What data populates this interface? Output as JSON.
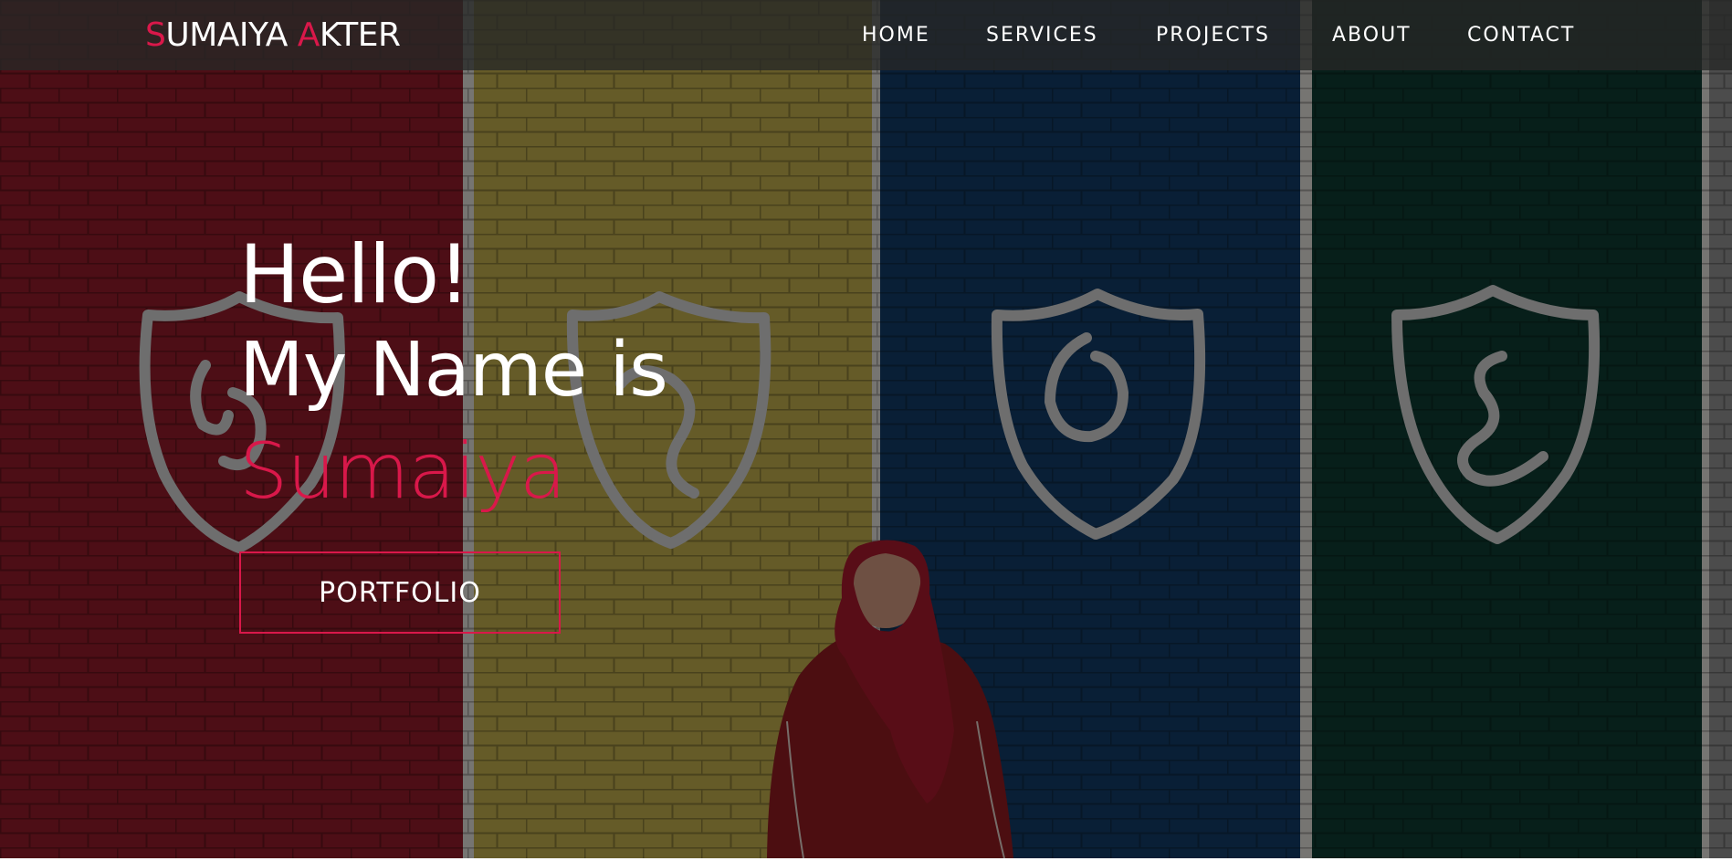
{
  "header": {
    "logo": {
      "first_initial": "S",
      "first_rest": "UMAIYA ",
      "last_initial": "A",
      "last_rest": "KTER"
    },
    "nav": [
      "HOME",
      "SERVICES",
      "PROJECTS",
      "ABOUT",
      "CONTACT"
    ]
  },
  "hero": {
    "line1": "Hello!",
    "line2": "My Name is",
    "name": "Sumaiya",
    "button_label": "PORTFOLIO"
  },
  "colors": {
    "accent": "#d9184a",
    "nav_bg": "#262826",
    "text": "#ffffff"
  }
}
